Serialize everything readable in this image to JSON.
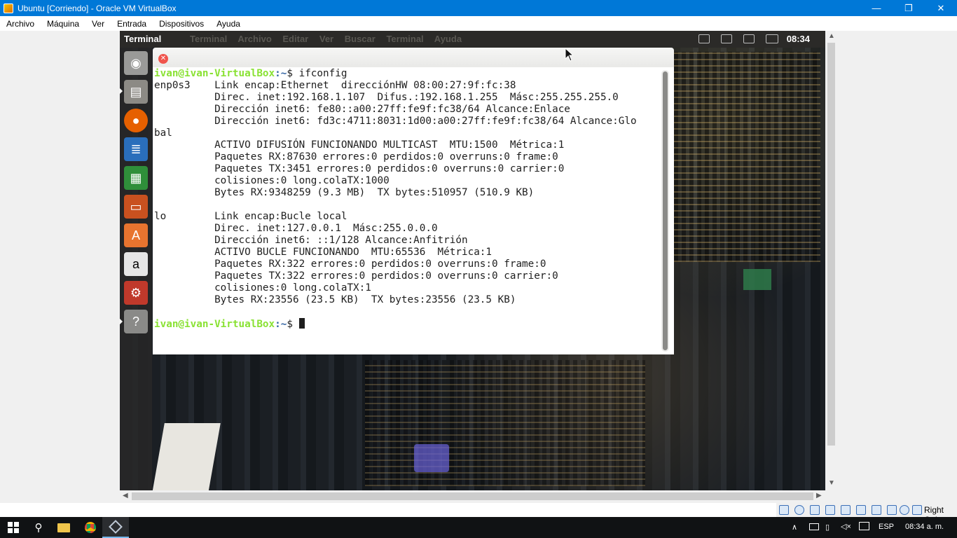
{
  "host_window": {
    "title": "Ubuntu [Corriendo] - Oracle VM VirtualBox",
    "minimize": "—",
    "maximize": "❐",
    "close": "✕"
  },
  "host_menu": [
    "Archivo",
    "Máquina",
    "Ver",
    "Entrada",
    "Dispositivos",
    "Ayuda"
  ],
  "ubuntu_panel": {
    "app_name": "Terminal",
    "menus": [
      "Terminal",
      "Archivo",
      "Editar",
      "Ver",
      "Buscar",
      "Terminal",
      "Ayuda"
    ],
    "clock": "08:34"
  },
  "launcher": {
    "items": [
      "dash-home",
      "files",
      "firefox",
      "libreoffice-writer",
      "libreoffice-calc",
      "libreoffice-impress",
      "ubuntu-software",
      "amazon",
      "system-settings",
      "help"
    ]
  },
  "terminal": {
    "prompt_user": "ivan@ivan-VirtualBox",
    "prompt_path": ":~",
    "command_line": "$ ifconfig",
    "final_prompt_suffix": "$ ",
    "output": [
      "enp0s3    Link encap:Ethernet  direcciónHW 08:00:27:9f:fc:38",
      "          Direc. inet:192.168.1.107  Difus.:192.168.1.255  Másc:255.255.255.0",
      "          Dirección inet6: fe80::a00:27ff:fe9f:fc38/64 Alcance:Enlace",
      "          Dirección inet6: fd3c:4711:8031:1d00:a00:27ff:fe9f:fc38/64 Alcance:Glo",
      "bal",
      "          ACTIVO DIFUSIÓN FUNCIONANDO MULTICAST  MTU:1500  Métrica:1",
      "          Paquetes RX:87630 errores:0 perdidos:0 overruns:0 frame:0",
      "          Paquetes TX:3451 errores:0 perdidos:0 overruns:0 carrier:0",
      "          colisiones:0 long.colaTX:1000",
      "          Bytes RX:9348259 (9.3 MB)  TX bytes:510957 (510.9 KB)",
      "",
      "lo        Link encap:Bucle local",
      "          Direc. inet:127.0.0.1  Másc:255.0.0.0",
      "          Dirección inet6: ::1/128 Alcance:Anfitrión",
      "          ACTIVO BUCLE FUNCIONANDO  MTU:65536  Métrica:1",
      "          Paquetes RX:322 errores:0 perdidos:0 overruns:0 frame:0",
      "          Paquetes TX:322 errores:0 perdidos:0 overruns:0 carrier:0",
      "          colisiones:0 long.colaTX:1",
      "          Bytes RX:23556 (23.5 KB)  TX bytes:23556 (23.5 KB)",
      ""
    ]
  },
  "vbox_status": {
    "host_key": "Right Ctrl"
  },
  "taskbar": {
    "language": "ESP",
    "time": "08:34 a. m."
  }
}
